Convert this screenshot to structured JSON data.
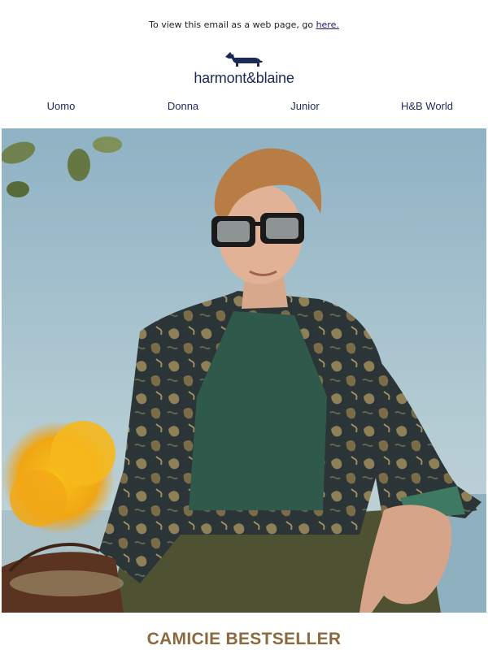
{
  "preheader": {
    "text": "To view this email as a web page, go ",
    "link_label": "here."
  },
  "brand": {
    "name": "harmont&blaine",
    "logo_icon": "dachshund-icon",
    "color": "#1b2a57"
  },
  "nav": {
    "items": [
      {
        "label": "Uomo"
      },
      {
        "label": "Donna"
      },
      {
        "label": "Junior"
      },
      {
        "label": "H&B World"
      }
    ]
  },
  "hero": {
    "image": "hero-photo"
  },
  "section": {
    "title": "CAMICIE BESTSELLER",
    "title_color": "#8a6a3e"
  }
}
